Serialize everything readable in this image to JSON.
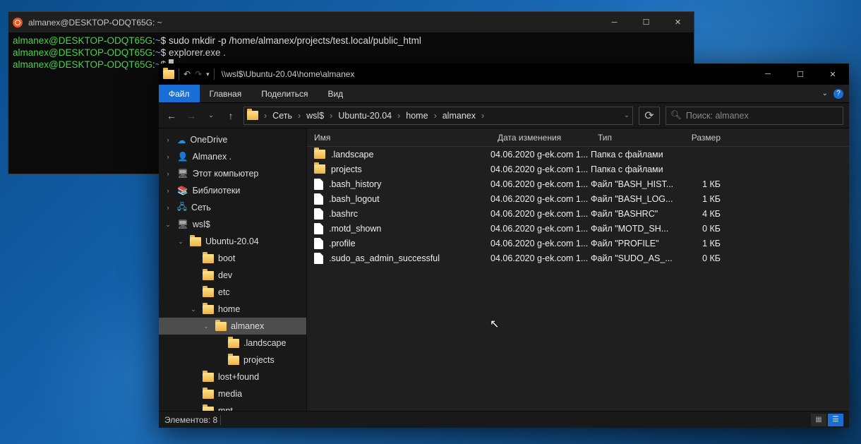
{
  "terminal": {
    "title": "almanex@DESKTOP-ODQT65G: ~",
    "lines": [
      {
        "user": "almanex@DESKTOP-ODQT65G",
        "path": "~",
        "cmd": "sudo mkdir -p /home/almanex/projects/test.local/public_html"
      },
      {
        "user": "almanex@DESKTOP-ODQT65G",
        "path": "~",
        "cmd": "explorer.exe ."
      },
      {
        "user": "almanex@DESKTOP-ODQT65G",
        "path": "~",
        "cmd": ""
      }
    ]
  },
  "explorer": {
    "title_path": "\\\\wsl$\\Ubuntu-20.04\\home\\almanex",
    "ribbon": {
      "file": "Файл",
      "home": "Главная",
      "share": "Поделиться",
      "view": "Вид"
    },
    "breadcrumbs": [
      "Сеть",
      "wsl$",
      "Ubuntu-20.04",
      "home",
      "almanex"
    ],
    "search_placeholder": "Поиск: almanex",
    "columns": {
      "name": "Имя",
      "date": "Дата изменения",
      "type": "Тип",
      "size": "Размер"
    },
    "tree": [
      {
        "indent": 0,
        "tw": "›",
        "icon": "cloud",
        "label": "OneDrive"
      },
      {
        "indent": 0,
        "tw": "›",
        "icon": "user",
        "label": "Almanex ."
      },
      {
        "indent": 0,
        "tw": "›",
        "icon": "pc",
        "label": "Этот компьютер"
      },
      {
        "indent": 0,
        "tw": "›",
        "icon": "lib",
        "label": "Библиотеки"
      },
      {
        "indent": 0,
        "tw": "›",
        "icon": "net",
        "label": "Сеть"
      },
      {
        "indent": 0,
        "tw": "⌄",
        "icon": "pc",
        "label": "wsl$"
      },
      {
        "indent": 1,
        "tw": "⌄",
        "icon": "folder",
        "label": "Ubuntu-20.04"
      },
      {
        "indent": 2,
        "tw": "",
        "icon": "folder",
        "label": "boot"
      },
      {
        "indent": 2,
        "tw": "",
        "icon": "folder",
        "label": "dev"
      },
      {
        "indent": 2,
        "tw": "",
        "icon": "folder",
        "label": "etc"
      },
      {
        "indent": 2,
        "tw": "⌄",
        "icon": "folder",
        "label": "home"
      },
      {
        "indent": 3,
        "tw": "⌄",
        "icon": "folder",
        "label": "almanex",
        "sel": true
      },
      {
        "indent": 4,
        "tw": "",
        "icon": "folder",
        "label": ".landscape"
      },
      {
        "indent": 4,
        "tw": "",
        "icon": "folder",
        "label": "projects"
      },
      {
        "indent": 2,
        "tw": "",
        "icon": "folder",
        "label": "lost+found"
      },
      {
        "indent": 2,
        "tw": "",
        "icon": "folder",
        "label": "media"
      },
      {
        "indent": 2,
        "tw": "",
        "icon": "folder",
        "label": "mnt"
      }
    ],
    "files": [
      {
        "icon": "folder",
        "name": ".landscape",
        "date": "04.06.2020 g-ek.com 1...",
        "type": "Папка с файлами",
        "size": ""
      },
      {
        "icon": "folder",
        "name": "projects",
        "date": "04.06.2020 g-ek.com 1...",
        "type": "Папка с файлами",
        "size": ""
      },
      {
        "icon": "file",
        "name": ".bash_history",
        "date": "04.06.2020 g-ek.com 1...",
        "type": "Файл \"BASH_HIST...",
        "size": "1 КБ"
      },
      {
        "icon": "file",
        "name": ".bash_logout",
        "date": "04.06.2020 g-ek.com 1...",
        "type": "Файл \"BASH_LOG...",
        "size": "1 КБ"
      },
      {
        "icon": "file",
        "name": ".bashrc",
        "date": "04.06.2020 g-ek.com 1...",
        "type": "Файл \"BASHRC\"",
        "size": "4 КБ"
      },
      {
        "icon": "file",
        "name": ".motd_shown",
        "date": "04.06.2020 g-ek.com 1...",
        "type": "Файл \"MOTD_SH...",
        "size": "0 КБ"
      },
      {
        "icon": "file",
        "name": ".profile",
        "date": "04.06.2020 g-ek.com 1...",
        "type": "Файл \"PROFILE\"",
        "size": "1 КБ"
      },
      {
        "icon": "file",
        "name": ".sudo_as_admin_successful",
        "date": "04.06.2020 g-ek.com 1...",
        "type": "Файл \"SUDO_AS_...",
        "size": "0 КБ"
      }
    ],
    "status": "Элементов: 8"
  }
}
